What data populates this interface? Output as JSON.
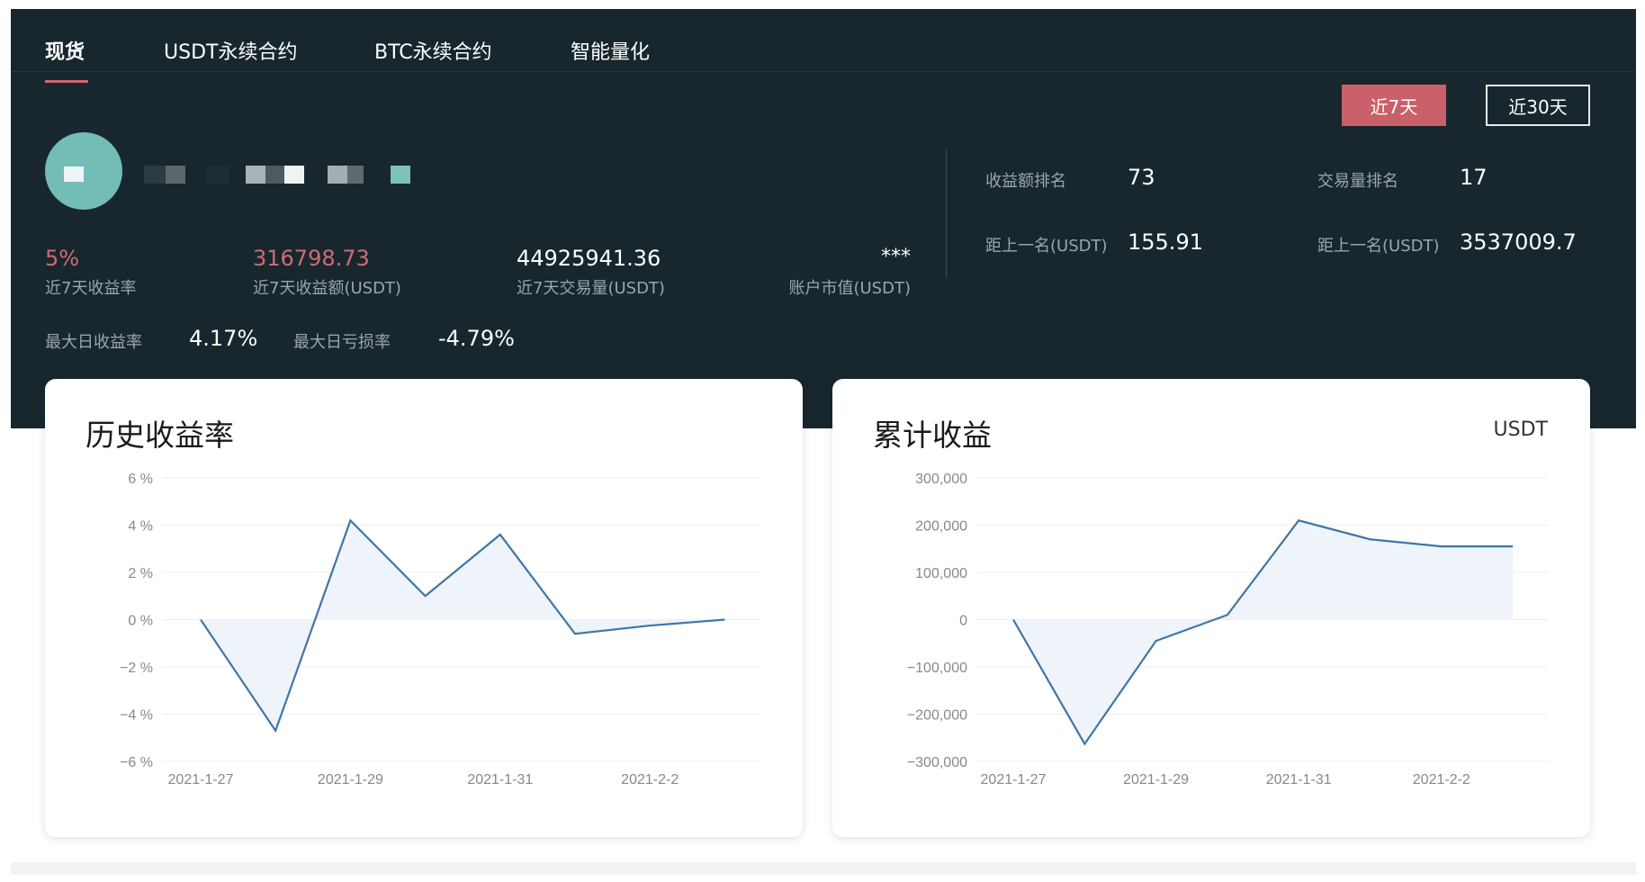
{
  "tabs": [
    {
      "label": "现货",
      "active": true
    },
    {
      "label": "USDT永续合约",
      "active": false
    },
    {
      "label": "BTC永续合约",
      "active": false
    },
    {
      "label": "智能量化",
      "active": false
    }
  ],
  "range_buttons": [
    {
      "label": "近7天",
      "active": true
    },
    {
      "label": "近30天",
      "active": false
    }
  ],
  "stats": {
    "yield_rate_7d": {
      "value": "5%",
      "label": "近7天收益率"
    },
    "profit_7d": {
      "value": "316798.73",
      "label": "近7天收益额(USDT)"
    },
    "volume_7d": {
      "value": "44925941.36",
      "label": "近7天交易量(USDT)"
    },
    "market_value": {
      "value": "***",
      "label": "账户市值(USDT)"
    },
    "max_daily_gain": {
      "label": "最大日收益率",
      "value": "4.17%"
    },
    "max_daily_loss": {
      "label": "最大日亏损率",
      "value": "-4.79%"
    }
  },
  "rankings": {
    "profit_rank": {
      "label": "收益额排名",
      "value": "73"
    },
    "volume_rank": {
      "label": "交易量排名",
      "value": "17"
    },
    "profit_gap": {
      "label": "距上一名(USDT)",
      "value": "155.91"
    },
    "volume_gap": {
      "label": "距上一名(USDT)",
      "value": "3537009.7"
    }
  },
  "colors": {
    "accent": "#c9606a",
    "panel_bg": "#18272e",
    "line": "#3f76a6",
    "area": "#eef4fa"
  },
  "chart_data": [
    {
      "type": "area",
      "title": "历史收益率",
      "x": [
        "2021-1-27",
        "2021-1-28",
        "2021-1-29",
        "2021-1-30",
        "2021-1-31",
        "2021-2-1",
        "2021-2-2",
        "2021-2-3"
      ],
      "values": [
        0,
        -4.7,
        4.2,
        1.0,
        3.6,
        -0.6,
        -0.25,
        0
      ],
      "y_unit": "%",
      "ylim": [
        -6,
        6
      ],
      "yticks": [
        6,
        4,
        2,
        0,
        -2,
        -4,
        -6
      ],
      "ytick_labels": [
        "6 %",
        "4 %",
        "2 %",
        "0 %",
        "−2 %",
        "−4 %",
        "−6 %"
      ],
      "xtick_labels": [
        "2021-1-27",
        "2021-1-29",
        "2021-1-31",
        "2021-2-2"
      ],
      "grid": true
    },
    {
      "type": "area",
      "title": "累计收益",
      "unit": "USDT",
      "x": [
        "2021-1-27",
        "2021-1-28",
        "2021-1-29",
        "2021-1-30",
        "2021-1-31",
        "2021-2-1",
        "2021-2-2",
        "2021-2-3"
      ],
      "values": [
        0,
        -263000,
        -45000,
        10000,
        210000,
        170000,
        155000,
        155000
      ],
      "ylim": [
        -300000,
        300000
      ],
      "yticks": [
        300000,
        200000,
        100000,
        0,
        -100000,
        -200000,
        -300000
      ],
      "ytick_labels": [
        "300,000",
        "200,000",
        "100,000",
        "0",
        "−100,000",
        "−200,000",
        "−300,000"
      ],
      "xtick_labels": [
        "2021-1-27",
        "2021-1-29",
        "2021-1-31",
        "2021-2-2"
      ],
      "grid": true
    }
  ]
}
